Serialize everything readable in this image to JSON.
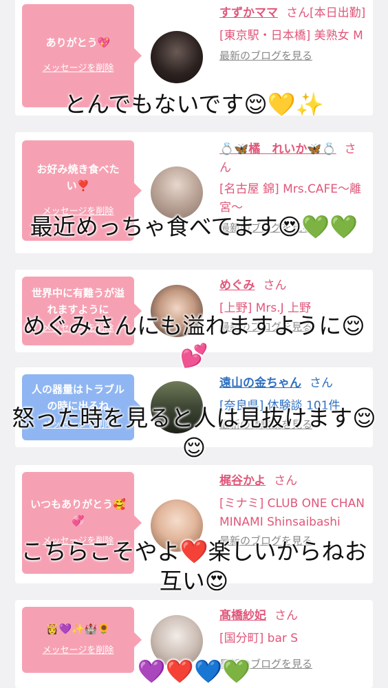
{
  "cards": [
    {
      "message": "ありがとう💖",
      "delete_label": "メッセージを削除",
      "name": "すずかママ",
      "san": "さん",
      "name_suffix": "[本日出勤]",
      "detail": "[東京駅・日本橋] 美熟女 M",
      "link": "最新のブログを見る"
    },
    {
      "message": "お好み焼き食べたい❣️",
      "delete_label": "メッセージを削除",
      "name": "💍🦋橘　れいか🦋💍",
      "san": "さん",
      "detail": "[名古屋 錦] Mrs.CAFE〜離宮〜",
      "link": "最新のブログを見る"
    },
    {
      "message": "世界中に有難うが溢れますように",
      "delete_label": "メッセージを削除",
      "name": "めぐみ",
      "san": "さん",
      "detail": "[上野] Mrs.J 上野",
      "link": "最新のブログを見る"
    },
    {
      "message": "人の器量はトラブルの時に出るね",
      "delete_label": "メッセージを削除",
      "name": "遠山の金ちゃん",
      "san": "さん",
      "detail": "[奈良県] 体験談 101件",
      "link": "最新の体験談を見る"
    },
    {
      "message": "いつもありがとう🥰💞",
      "delete_label": "メッセージを削除",
      "name": "梶谷かよ",
      "san": "さん",
      "detail": "[ミナミ] CLUB ONE CHAN MINAMI Shinsaibashi",
      "link": "最新のブログを見る"
    },
    {
      "message": "👸💜✨🏰🌻",
      "delete_label": "メッセージを削除",
      "name": "髙橋紗妃",
      "san": "さん",
      "detail": "[国分町] bar S",
      "link": "最新のブログを見る"
    }
  ],
  "captions": [
    "とんでもないです😌💛✨",
    "最近めっちゃ食べてます😍💚💚",
    "めぐみさんにも溢れますように😌💕",
    "怒った時を見ると人は見抜けます😌😌",
    "こちらこそやよ❤️楽しいからねお互い😍",
    "💜❤️💙💚"
  ],
  "colors": {
    "pink_bubble": "#f6a1b3",
    "blue_bubble": "#8fb6f2",
    "pink_text": "#e0577a",
    "blue_text": "#2d6fc0"
  }
}
